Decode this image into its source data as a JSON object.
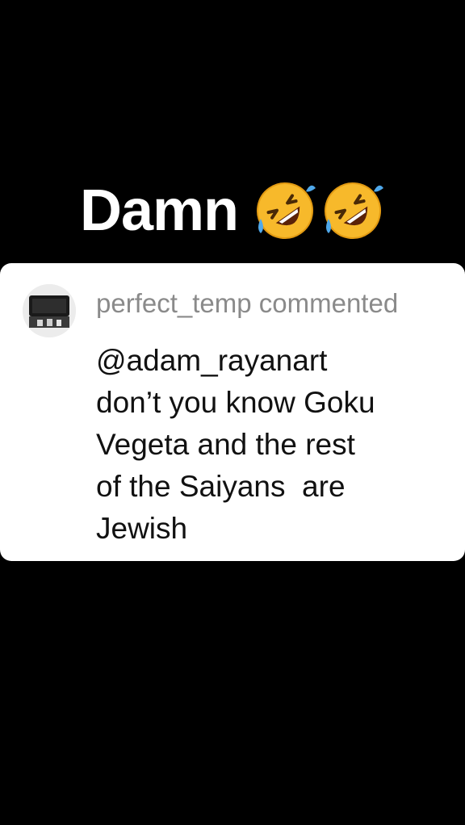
{
  "caption": {
    "text": "Damn",
    "emoji": [
      "rolling-on-floor-laughing-emoji",
      "rolling-on-floor-laughing-emoji"
    ]
  },
  "comment_card": {
    "avatar_icon": "user-avatar",
    "header": "perfect_temp commented",
    "body_lines": [
      "@adam_rayanart",
      "don’t you know Goku",
      "Vegeta and the rest",
      "of the Saiyans  are",
      "Jewish"
    ]
  },
  "colors": {
    "background": "#000000",
    "card": "#ffffff",
    "caption_text": "#ffffff",
    "header_text": "#8a8a8a",
    "body_text": "#111111",
    "emoji_face": "#f7b92b"
  }
}
